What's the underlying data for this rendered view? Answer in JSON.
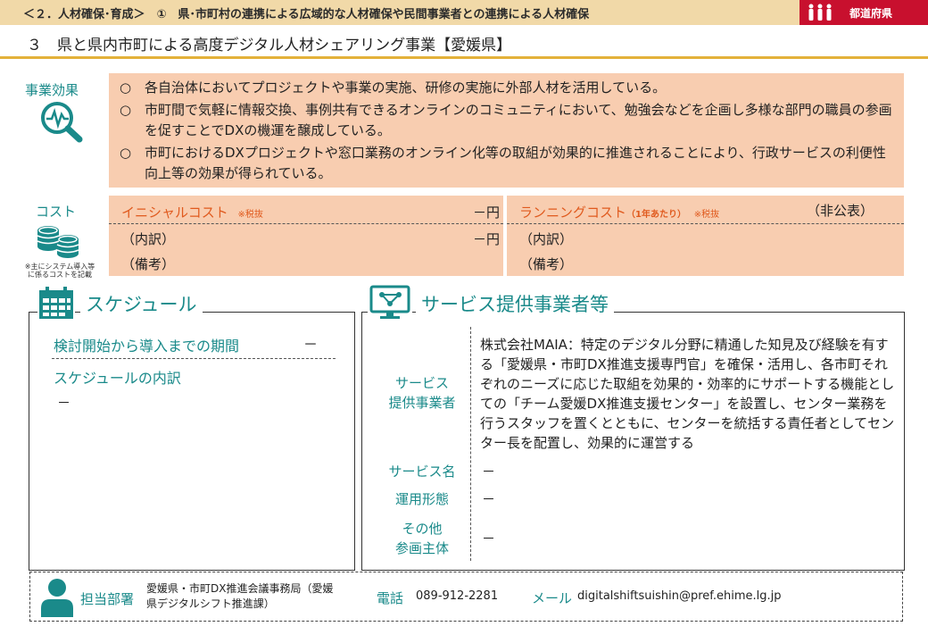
{
  "header": {
    "breadcrumb": "＜２．人材確保･育成＞　①　県･市町村の連携による広域的な人材確保や民間事業者との連携による人材確保",
    "badge": "都道府県",
    "title": "３　県と県内市町による高度デジタル人材シェアリング事業【愛媛県】"
  },
  "effects": {
    "label": "事業効果",
    "marker": "○",
    "items": [
      "各自治体においてプロジェクトや事業の実施、研修の実施に外部人材を活用している。",
      "市町間で気軽に情報交換、事例共有できるオンラインのコミュニティにおいて、勉強会などを企画し多様な部門の職員の参画を促すことでDXの機運を醸成している。",
      "市町におけるDXプロジェクトや窓口業務のオンライン化等の取組が効果的に推進されることにより、行政サービスの利便性向上等の効果が得られている。"
    ]
  },
  "cost": {
    "label": "コスト",
    "note": "※主にシステム導入等に係るコストを記載",
    "initial": {
      "title": "イニシャルコスト",
      "tax": "※税抜",
      "amount": "－円",
      "breakdown": "（内訳）",
      "breakdown_amount": "－円",
      "remarks": "（備考）"
    },
    "running": {
      "title": "ランニングコスト",
      "per_year": "（1年あたり）",
      "tax": "※税抜",
      "amount": "（非公表）",
      "breakdown": "（内訳）",
      "remarks": "（備考）"
    }
  },
  "schedule": {
    "title": "スケジュール",
    "period_label": "検討開始から導入までの期間",
    "period_value": "－",
    "breakdown_label": "スケジュールの内訳",
    "breakdown_value": "－"
  },
  "provider": {
    "title": "サービス提供事業者等",
    "provider_label_1": "サービス",
    "provider_label_2": "提供事業者",
    "provider_text": "株式会社MAIA：特定のデジタル分野に精通した知見及び経験を有する「愛媛県・市町DX推進支援専門官」を確保・活用し、各市町それぞれのニーズに応じた取組を効果的・効率的にサポートする機能としての「チーム愛媛DX推進支援センター」を設置し、センター業務を行うスタッフを置くとともに、センターを統括する責任者としてセンター長を配置し、効果的に運営する",
    "service_name_label": "サービス名",
    "service_name_value": "－",
    "operation_label": "運用形態",
    "operation_value": "－",
    "other_label_1": "その他",
    "other_label_2": "参画主体",
    "other_value": "－"
  },
  "contact": {
    "dept_label": "担当部署",
    "dept_value_1": "愛媛県・市町DX推進会議事務局（愛媛",
    "dept_value_2": "県デジタルシフト推進課）",
    "phone_label": "電話",
    "phone": "089-912-2281",
    "mail_label": "メール",
    "email": "digitalshiftsuishin@pref.ehime.lg.jp"
  },
  "colors": {
    "accent": "#1a8a8a",
    "peach": "#f8cdb0",
    "orange": "#e05a1e",
    "gold": "#e3b13a",
    "red": "#c8102e"
  }
}
